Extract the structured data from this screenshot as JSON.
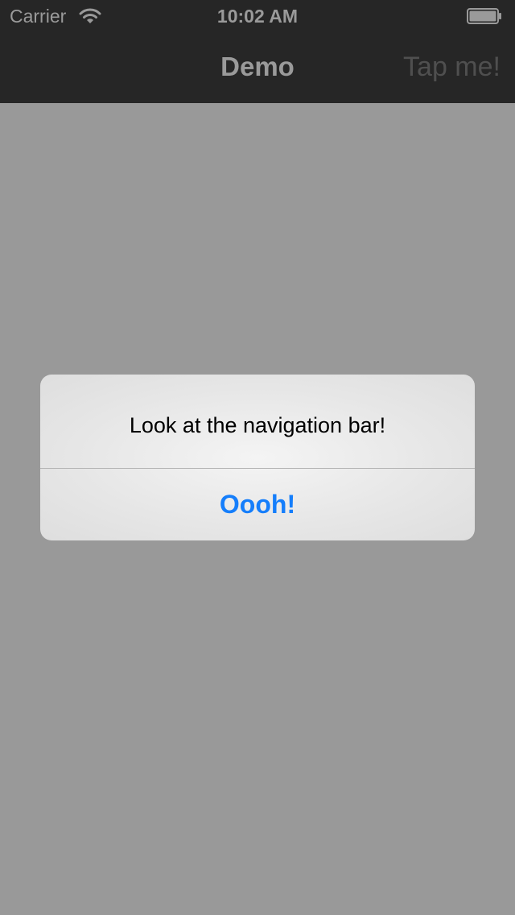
{
  "status_bar": {
    "carrier": "Carrier",
    "time": "10:02 AM",
    "wifi_icon": "wifi-icon",
    "battery_icon": "battery-icon",
    "battery_level": 1.0
  },
  "nav_bar": {
    "title": "Demo",
    "right_button": "Tap me!"
  },
  "alert": {
    "message": "Look at the navigation bar!",
    "button": "Oooh!"
  },
  "colors": {
    "background": "#999999",
    "top_bar": "#262626",
    "accent": "#157efb"
  }
}
